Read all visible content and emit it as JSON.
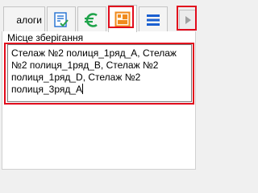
{
  "tabs": {
    "text_tab_label": "алоги",
    "doc_tab": {
      "icon": "document-check-icon"
    },
    "euro_tab": {
      "icon": "euro-icon"
    },
    "image_tab": {
      "icon": "image-icon"
    },
    "list_tab": {
      "icon": "list-icon"
    },
    "next_arrow": {
      "icon": "triangle-right-icon"
    }
  },
  "field": {
    "label": "Місце зберігання",
    "value": "Стелаж №2 полиця_1ряд_А, Стелаж №2 полиця_1ряд_В, Стелаж №2 полиця_1ряд_D, Стелаж №2 полиця_3ряд_А"
  },
  "colors": {
    "highlight": "#e10b1c",
    "doc_icon_blue": "#1f6fd1",
    "doc_icon_check": "#2aa14a",
    "euro_green": "#1fa34a",
    "image_orange": "#f08a1c",
    "list_blue": "#1a5fd0",
    "arrow_gray": "#a0a0a0"
  }
}
